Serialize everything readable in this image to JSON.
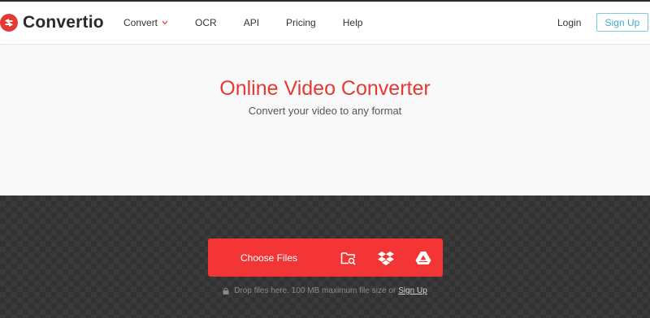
{
  "header": {
    "brand": "Convertio",
    "nav": [
      {
        "label": "Convert",
        "has_dropdown": true
      },
      {
        "label": "OCR"
      },
      {
        "label": "API"
      },
      {
        "label": "Pricing"
      },
      {
        "label": "Help"
      }
    ],
    "login_label": "Login",
    "signup_label": "Sign Up"
  },
  "hero": {
    "title": "Online Video Converter",
    "subtitle": "Convert your video to any format"
  },
  "upload": {
    "choose_label": "Choose Files",
    "icons": [
      "folder-search-icon",
      "dropbox-icon",
      "google-drive-icon"
    ],
    "drop_text": "Drop files here. 100 MB maximum file size or",
    "drop_link": "Sign Up"
  },
  "colors": {
    "brand_red": "#f33535",
    "title_red": "#e53935",
    "signup_blue": "#46a9cf",
    "dark_bg": "#323232"
  }
}
